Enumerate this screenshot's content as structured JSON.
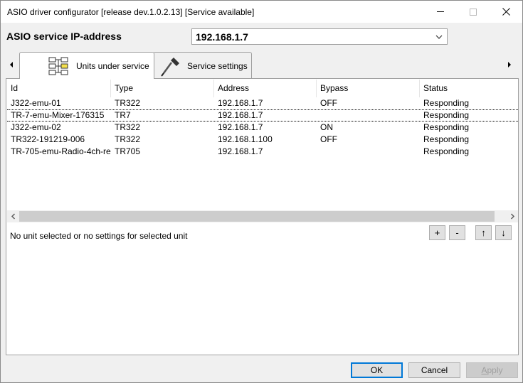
{
  "window": {
    "title": "ASIO driver configurator [release dev.1.0.2.13] [Service available]"
  },
  "ip": {
    "label": "ASIO service IP-address",
    "value": "192.168.1.7"
  },
  "tabs": [
    {
      "label": "Units under service",
      "icon": "units-grid-icon",
      "active": true
    },
    {
      "label": "Service settings",
      "icon": "screwdriver-icon",
      "active": false
    }
  ],
  "grid": {
    "columns": [
      "Id",
      "Type",
      "Address",
      "Bypass",
      "Status"
    ],
    "rows": [
      [
        "J322-emu-01",
        "TR322",
        "192.168.1.7",
        "OFF",
        "Responding"
      ],
      [
        "TR-7-emu-Mixer-176315",
        "TR7",
        "192.168.1.7",
        "",
        "Responding"
      ],
      [
        "J322-emu-02",
        "TR322",
        "192.168.1.7",
        "ON",
        "Responding"
      ],
      [
        "TR322-191219-006",
        "TR322",
        "192.168.1.100",
        "OFF",
        "Responding"
      ],
      [
        "TR-705-emu-Radio-4ch-re...",
        "TR705",
        "192.168.1.7",
        "",
        "Responding"
      ]
    ],
    "selected_row": 1
  },
  "unit_status": "No unit selected or no settings for selected unit",
  "unit_buttons": {
    "add": "+",
    "remove": "-",
    "up": "↑",
    "down": "↓"
  },
  "footer": {
    "ok": "OK",
    "cancel": "Cancel",
    "apply_underlined": "A",
    "apply_rest": "pply"
  }
}
